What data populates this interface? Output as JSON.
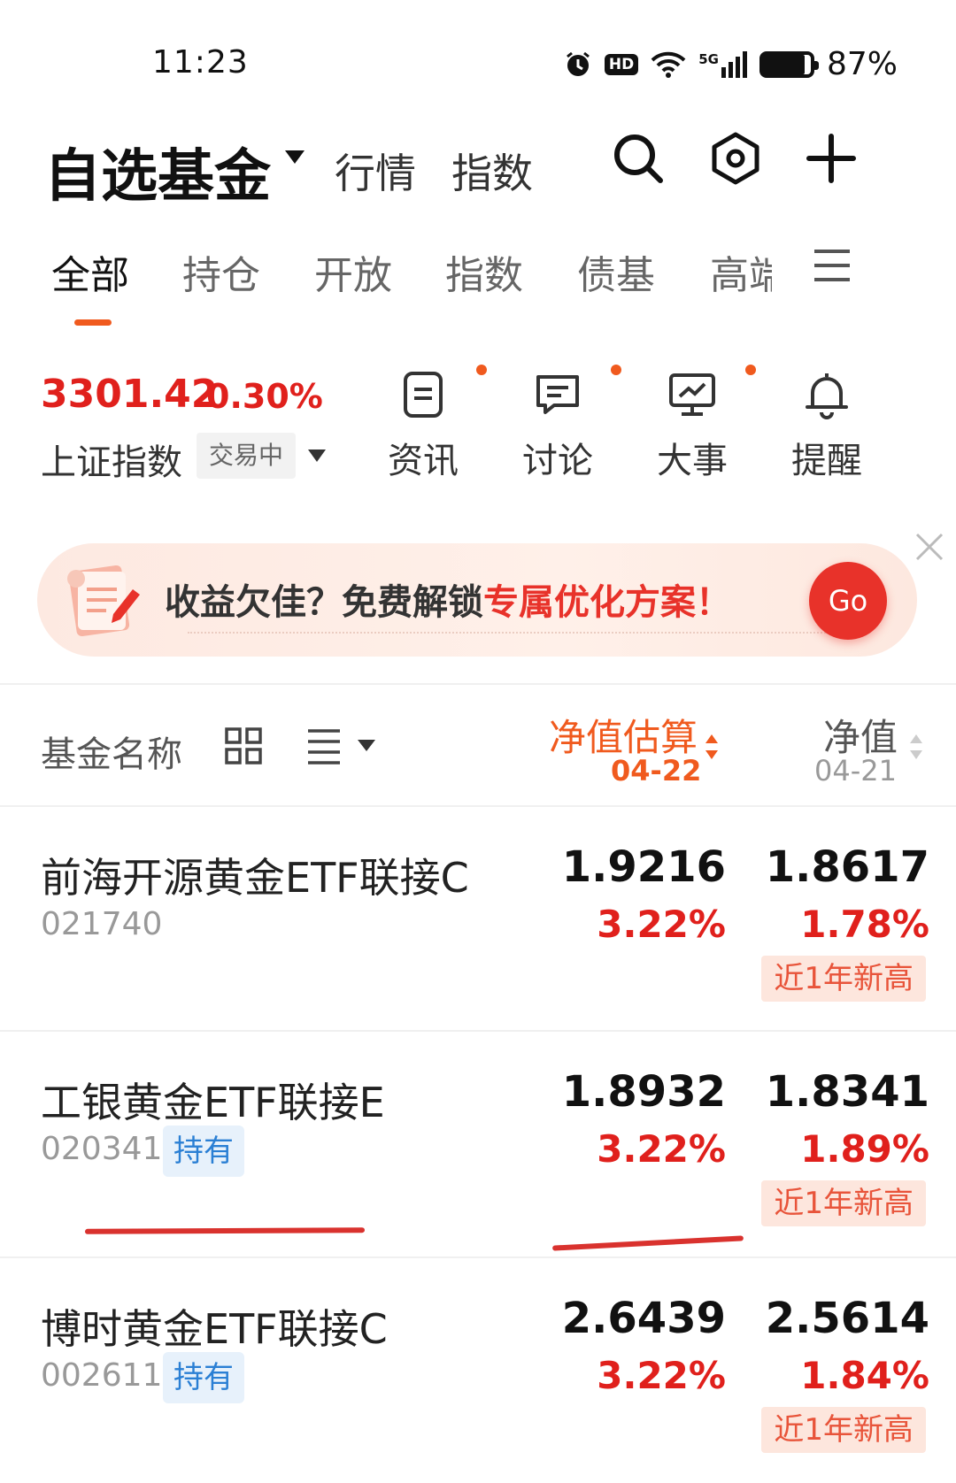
{
  "status_bar": {
    "time": "11:23",
    "battery": "87%",
    "battery_level": 0.87,
    "hd_label": "HD",
    "network_label": "5G"
  },
  "header": {
    "title": "自选基金",
    "tabs": [
      "行情",
      "指数"
    ]
  },
  "category_tabs": [
    "全部",
    "持仓",
    "开放",
    "指数",
    "债基",
    "高端"
  ],
  "index": {
    "value": "3301.42",
    "change": "0.30%",
    "name": "上证指数",
    "status": "交易中"
  },
  "quick_links": [
    "资讯",
    "讨论",
    "大事",
    "提醒"
  ],
  "banner": {
    "text_main": "收益欠佳？免费解锁",
    "text_highlight": "专属优化方案！",
    "button": "Go"
  },
  "list_header": {
    "name_col": "基金名称",
    "est_col": "净值估算",
    "est_date": "04-22",
    "nav_col": "净值",
    "nav_date": "04-21"
  },
  "funds": [
    {
      "name": "前海开源黄金ETF联接C",
      "code": "021740",
      "badge": "",
      "est": "1.9216",
      "est_pct": "3.22%",
      "nav": "1.8617",
      "nav_pct": "1.78%",
      "tag": "近1年新高"
    },
    {
      "name": "工银黄金ETF联接E",
      "code": "020341",
      "badge": "持有",
      "est": "1.8932",
      "est_pct": "3.22%",
      "nav": "1.8341",
      "nav_pct": "1.89%",
      "tag": "近1年新高"
    },
    {
      "name": "博时黄金ETF联接C",
      "code": "002611",
      "badge": "持有",
      "est": "2.6439",
      "est_pct": "3.22%",
      "nav": "2.5614",
      "nav_pct": "1.84%",
      "tag": "近1年新高"
    }
  ],
  "colors": {
    "accent": "#f05a1e",
    "up": "#e0201c",
    "badge_blue": "#2a7fd4"
  }
}
